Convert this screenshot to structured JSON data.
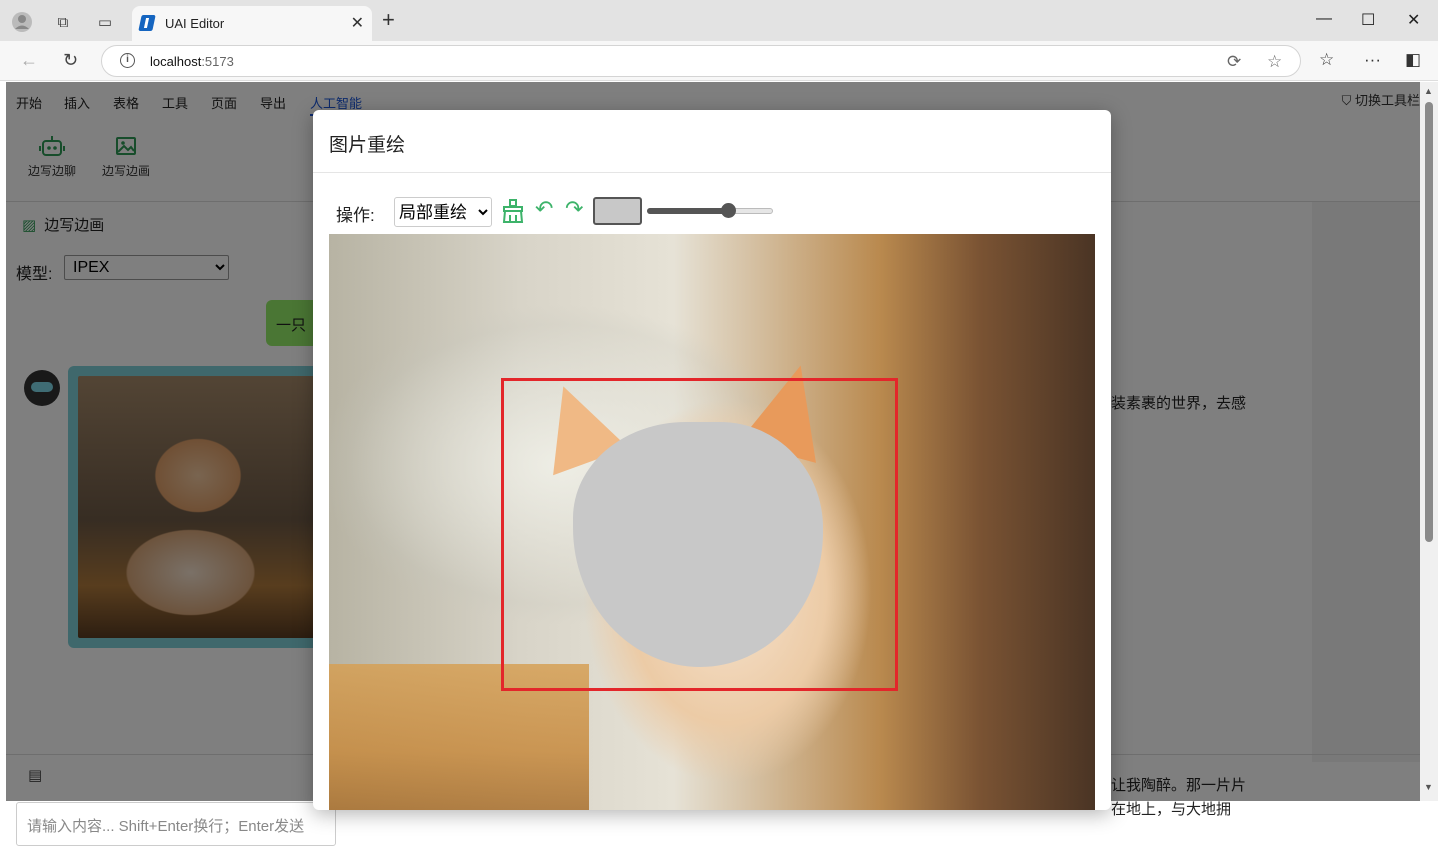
{
  "browser": {
    "tab_title": "UAI Editor",
    "url_host": "localhost",
    "url_port": ":5173"
  },
  "app": {
    "menu": [
      "开始",
      "插入",
      "表格",
      "工具",
      "页面",
      "导出",
      "人工智能"
    ],
    "active_menu": "人工智能",
    "toggle_toolbar": "切换工具栏",
    "ribbon": [
      {
        "label": "边写边聊",
        "icon": "robot-icon"
      },
      {
        "label": "边写边画",
        "icon": "image-icon"
      }
    ],
    "panel": {
      "title": "边写边画",
      "model_label": "模型:",
      "model_value": "IPEX",
      "user_bubble": "一只",
      "input_placeholder": "请输入内容... Shift+Enter换行；Enter发送"
    },
    "doc_lines": [
      "装素裹的世界，去感",
      "让我陶醉。那一片片",
      "在地上，与大地拥"
    ]
  },
  "dialog": {
    "title": "图片重绘",
    "op_label": "操作:",
    "op_value": "局部重绘",
    "brush_color": "#c8c8c8",
    "brush_size_fraction": 0.64,
    "accent_color": "#3db36a",
    "selection_color": "#e3262a"
  }
}
